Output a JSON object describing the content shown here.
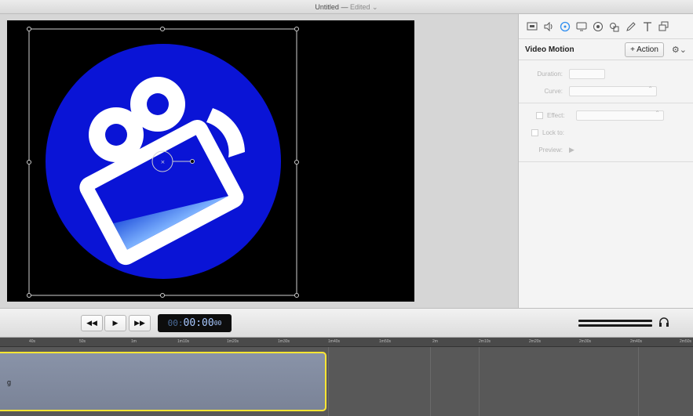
{
  "window": {
    "title": "Untitled",
    "separator": "—",
    "status": "Edited",
    "status_chevron": "⌄"
  },
  "inspector": {
    "tool_icons": [
      "screen-icon",
      "audio-icon",
      "motion-icon",
      "display-icon",
      "target-icon",
      "shapes-icon",
      "pen-icon",
      "text-icon",
      "layers-icon"
    ],
    "title": "Video Motion",
    "action_button": "+ Action",
    "gear": "⚙⌄",
    "properties": {
      "duration_label": "Duration:",
      "curve_label": "Curve:",
      "effect_label": "Effect:",
      "lock_label": "Lock to:",
      "preview_label": "Preview:"
    }
  },
  "transport": {
    "rewind": "◀◀",
    "play": "▶",
    "forward": "▶▶",
    "timecode_dim": "00:",
    "timecode_main": "00:00",
    "timecode_sub": "00"
  },
  "timeline": {
    "ticks": [
      "40s",
      "50s",
      "1m",
      "1m10s",
      "1m20s",
      "1m30s",
      "1m40s",
      "1m50s",
      "2m",
      "2m10s",
      "2m20s",
      "2m30s",
      "2m40s",
      "2m50s"
    ],
    "clip_label": "g"
  },
  "colors": {
    "accent_circle": "#0a14d6",
    "clip_border": "#ffe633",
    "timecode_text": "#a8c8ff"
  }
}
